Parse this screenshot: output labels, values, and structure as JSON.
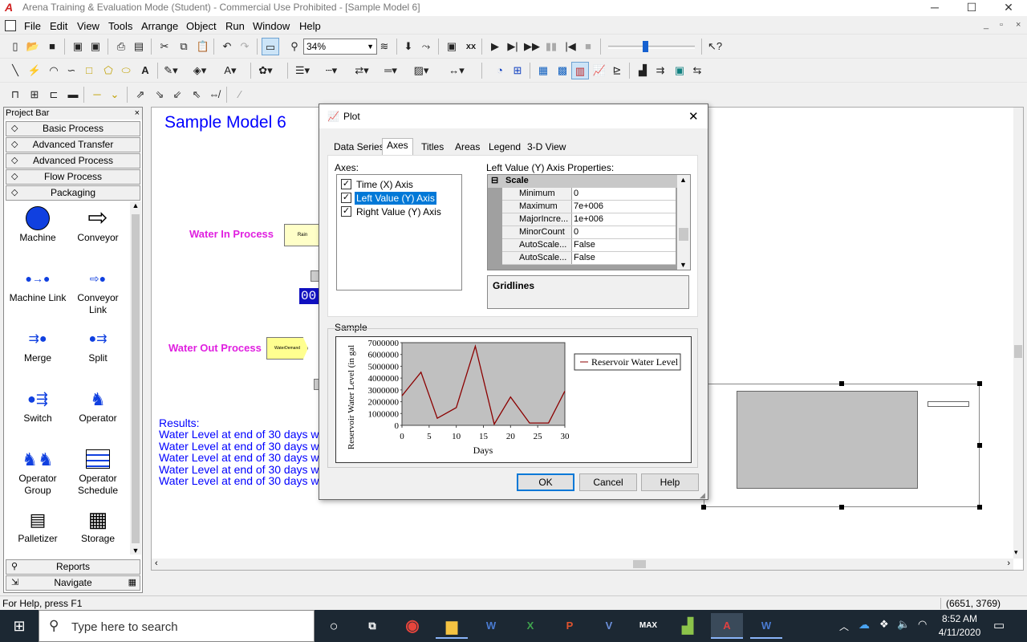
{
  "window": {
    "title": "Arena Training & Evaluation Mode (Student) - Commercial Use Prohibited - [Sample Model 6]",
    "app_icon": "A",
    "minimize": "─",
    "maximize": "☐",
    "close": "✕"
  },
  "menu": [
    "File",
    "Edit",
    "View",
    "Tools",
    "Arrange",
    "Object",
    "Run",
    "Window",
    "Help"
  ],
  "toolbar": {
    "zoom": "34%"
  },
  "project_bar": {
    "title": "Project Bar",
    "close": "×",
    "panels": [
      "Basic Process",
      "Advanced Transfer",
      "Advanced Process",
      "Flow Process",
      "Packaging"
    ],
    "palette_items": [
      "Machine",
      "Conveyor",
      "Machine Link",
      "Conveyor Link",
      "Merge",
      "Split",
      "Switch",
      "Operator",
      "Operator Group",
      "Operator Schedule",
      "Palletizer",
      "Storage"
    ],
    "bottom_panels": [
      "Reports",
      "Navigate"
    ]
  },
  "canvas": {
    "model_title": "Sample Model 6",
    "water_in_label": "Water In Process",
    "water_in_box": "Rain",
    "water_out_label": "Water Out Process",
    "water_out_box": "WaterDemand",
    "counter": "00",
    "results_title": "Results:",
    "results_lines": [
      "Water Level at end of 30 days wi",
      "Water Level at end of 30 days wi",
      "Water Level at end of 30 days wi",
      "Water Level at end of 30 days wi",
      "Water Level at end of 30 days wi"
    ]
  },
  "dialog": {
    "title": "Plot",
    "close": "✕",
    "tabs": [
      "Data Series",
      "Axes",
      "Titles",
      "Areas",
      "Legend",
      "3-D View"
    ],
    "active_tab": "Axes",
    "axes_label": "Axes:",
    "axes": [
      {
        "label": "Time (X) Axis",
        "checked": true
      },
      {
        "label": "Left Value (Y) Axis",
        "checked": true,
        "selected": true
      },
      {
        "label": "Right Value (Y) Axis",
        "checked": true
      }
    ],
    "props_title": "Left Value (Y) Axis Properties:",
    "props_group": "Scale",
    "props_toggle": "⊟",
    "props": [
      {
        "name": "Minimum",
        "value": "0"
      },
      {
        "name": "Maximum",
        "value": "7e+006"
      },
      {
        "name": "MajorIncre...",
        "value": "1e+006"
      },
      {
        "name": "MinorCount",
        "value": "0"
      },
      {
        "name": "AutoScale...",
        "value": "False"
      },
      {
        "name": "AutoScale...",
        "value": "False"
      }
    ],
    "description_title": "Gridlines",
    "sample_label": "Sample",
    "buttons": {
      "ok": "OK",
      "cancel": "Cancel",
      "help": "Help"
    }
  },
  "chart_data": {
    "type": "line",
    "title": "",
    "xlabel": "Days",
    "ylabel": "Reservoir Water Level (in gal",
    "xlim": [
      0,
      30
    ],
    "ylim": [
      0,
      7000000
    ],
    "xticks": [
      0,
      5,
      10,
      15,
      20,
      25,
      30
    ],
    "yticks": [
      0,
      1000000,
      2000000,
      3000000,
      4000000,
      5000000,
      6000000,
      7000000
    ],
    "grid": false,
    "legend_position": "right",
    "series": [
      {
        "name": "Reservoir Water Level",
        "color": "#8b0000",
        "x": [
          0,
          3.5,
          6.5,
          10,
          13.5,
          17,
          20,
          23.5,
          27,
          30
        ],
        "y": [
          2500000,
          4500000,
          600000,
          1500000,
          6700000,
          100000,
          2400000,
          200000,
          200000,
          2900000
        ]
      }
    ]
  },
  "status": {
    "help": "For Help, press F1",
    "coords": "(6651, 3769)"
  },
  "taskbar": {
    "search_placeholder": "Type here to search",
    "time": "8:52 AM",
    "date": "4/11/2020"
  },
  "colors": {
    "accent_blue": "#0000ff",
    "label_magenta": "#e020e0",
    "selection_blue": "#0078d7",
    "plot_gray": "#c0c0c0"
  }
}
